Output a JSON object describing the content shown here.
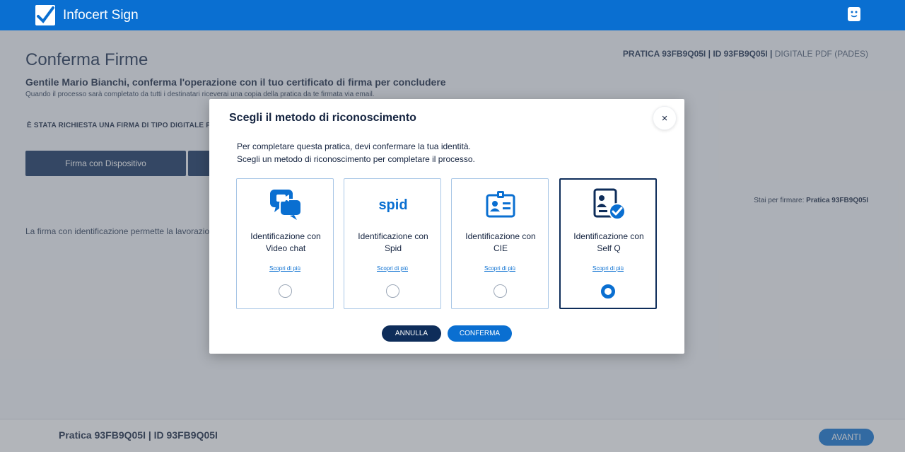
{
  "header": {
    "brand": "Infocert Sign",
    "logo_icon": "infocert-check-logo",
    "right_icon": "chat-face-icon",
    "color": "#0a6fd1"
  },
  "page": {
    "title": "Conferma Firme",
    "pratica_prefix": "PRATICA 93FB9Q05I",
    "id_label": "ID 93FB9Q05I",
    "separator": "|",
    "firma_type": "DIGITALE PDF (PADES)",
    "greeting": "Gentile Mario Bianchi, conferma l'operazione con il tuo certificato di firma per concludere",
    "subnote": "Quando il processo sarà completato da tutti i destinatari riceverai una copia della pratica da te firmata via email.",
    "firma_richiesta": "È STATA RICHIESTA UNA FIRMA DI TIPO DIGITALE PDF",
    "btn_dispositivo": "Firma con Dispositivo",
    "stai_firmare_label": "Stai per firmare:",
    "stai_firmare_value": "Pratica 93FB9Q05I",
    "note": "La firma con identificazione permette la lavorazio"
  },
  "footer": {
    "text": "Pratica 93FB9Q05I | ID 93FB9Q05I",
    "avanti": "AVANTI"
  },
  "modal": {
    "title": "Scegli il metodo di riconoscimento",
    "close": "×",
    "intro_line1": "Per completare questa pratica, devi confermare la tua identità.",
    "intro_line2": "Scegli un metodo di riconoscimento per completare il processo.",
    "options": [
      {
        "label": "Identificazione con Video chat",
        "link": "Scopri di più",
        "icon": "video-chat-icon",
        "selected": false
      },
      {
        "label": "Identificazione con Spid",
        "link": "Scopri di più",
        "icon": "spid-icon",
        "icon_text": "spid",
        "selected": false
      },
      {
        "label": "Identificazione con CIE",
        "link": "Scopri di più",
        "icon": "id-card-icon",
        "selected": false
      },
      {
        "label": "Identificazione con Self Q",
        "link": "Scopri di più",
        "icon": "self-q-icon",
        "selected": true
      }
    ],
    "annulla": "ANNULLA",
    "conferma": "CONFERMA"
  },
  "colors": {
    "primary": "#0a6fd1",
    "dark_navy": "#0e2d5a",
    "text": "#14233f"
  }
}
